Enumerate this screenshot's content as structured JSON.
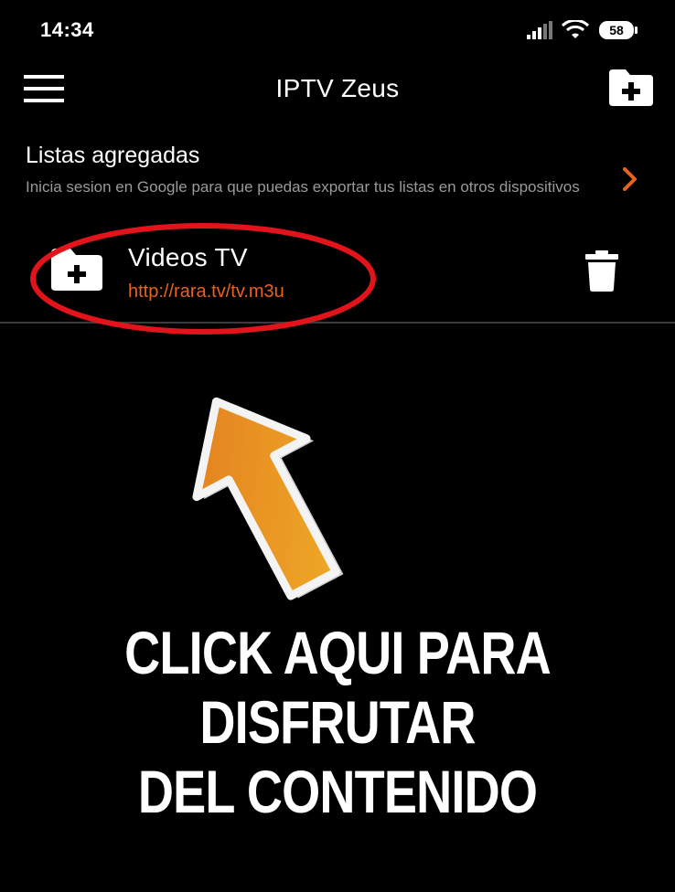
{
  "status_bar": {
    "time": "14:34",
    "battery_level": "58",
    "icons": [
      "signal-icon",
      "wifi-icon",
      "battery-icon"
    ]
  },
  "app_bar": {
    "title": "IPTV Zeus",
    "left_icon": "hamburger-menu-icon",
    "right_icon": "add-folder-icon"
  },
  "section": {
    "title": "Listas agregadas",
    "subtitle": "Inicia sesion en Google para que puedas exportar tus listas en otros dispositivos",
    "chevron_icon": "chevron-right-icon"
  },
  "lists": [
    {
      "name": "Videos TV",
      "url": "http://rara.tv/tv.m3u",
      "icon": "add-folder-icon",
      "action_icon": "trash-icon"
    }
  ],
  "overlay": {
    "caption_lines": [
      "CLICK AQUI PARA",
      "DISFRUTAR",
      "DEL CONTENIDO"
    ],
    "arrow_icon": "arrow-up-icon",
    "highlight": "red-ellipse"
  },
  "colors": {
    "background": "#000000",
    "accent": "#e8621f",
    "highlight_red": "#e3131b",
    "arrow_orange": "#e88a1e",
    "subtitle_gray": "#9a9a9a"
  }
}
